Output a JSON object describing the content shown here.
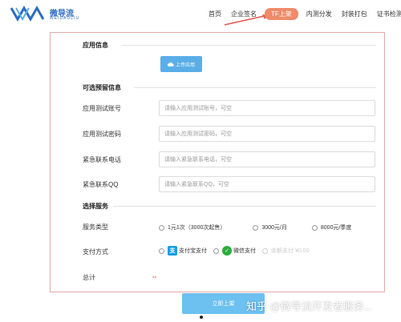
{
  "header": {
    "logo_text": "微导流",
    "logo_sub": "WEIDAOLIU",
    "nav": [
      "首页",
      "企业签名",
      "TF上架",
      "内测分发",
      "封装打包",
      "证书检测"
    ],
    "active_index": 2
  },
  "sections": {
    "app_info": "应用信息",
    "optional_info": "可选预留信息",
    "select_service": "选择服务"
  },
  "upload": {
    "label": "上传应用"
  },
  "fields": [
    {
      "label": "应用测试账号",
      "placeholder": "请输入应用测试账号，可空"
    },
    {
      "label": "应用测试密码",
      "placeholder": "请输入应用测试密码，可空"
    },
    {
      "label": "紧急联系电话",
      "placeholder": "请输入紧急联系电话，可空"
    },
    {
      "label": "紧急联系QQ",
      "placeholder": "请输入紧急联系QQ，可空"
    }
  ],
  "service_type": {
    "label": "服务类型",
    "options": [
      "1元1次（3000次起售）",
      "3000元/月",
      "8000元/季度"
    ]
  },
  "payment": {
    "label": "支付方式",
    "alipay": "支付宝支付",
    "wechat": "微信支付",
    "balance": "余额支付 ¥0.00"
  },
  "total": {
    "label": "总计",
    "value": "--"
  },
  "submit": {
    "label": "立即上架"
  },
  "watermark": "知乎 @微导流开发者服务..."
}
